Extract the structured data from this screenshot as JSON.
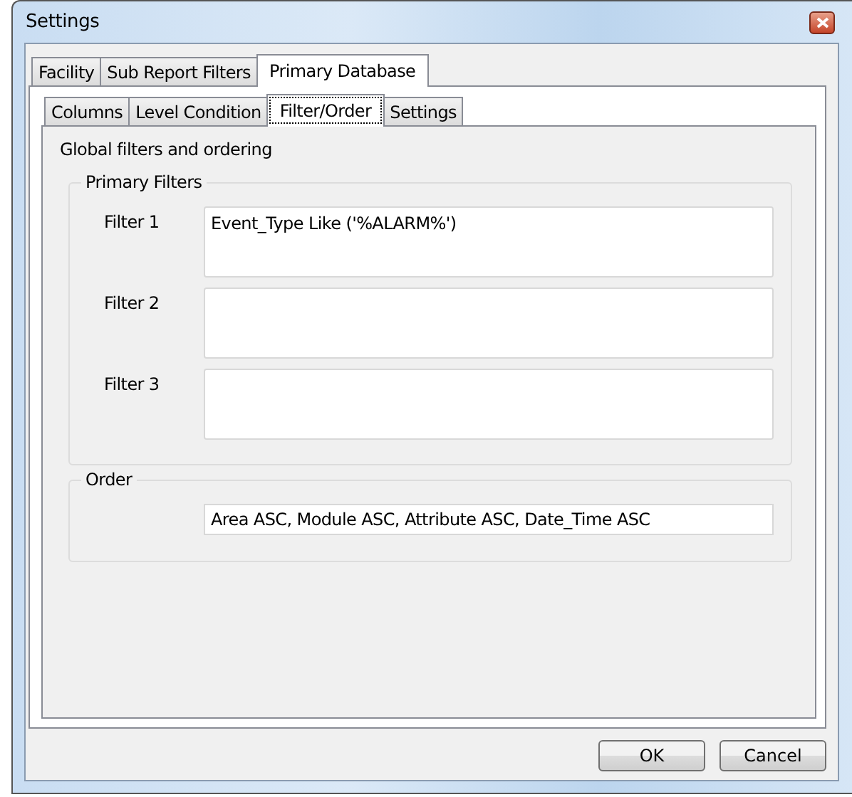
{
  "window": {
    "title": "Settings"
  },
  "tabs": [
    {
      "label": "Facility",
      "selected": false
    },
    {
      "label": "Sub Report Filters",
      "selected": false
    },
    {
      "label": "Primary Database",
      "selected": true
    }
  ],
  "subtabs": [
    {
      "label": "Columns",
      "selected": false
    },
    {
      "label": "Level Condition",
      "selected": false
    },
    {
      "label": "Filter/Order",
      "selected": true
    },
    {
      "label": "Settings",
      "selected": false
    }
  ],
  "description": "Global filters and ordering",
  "primary_filters": {
    "title": "Primary Filters",
    "filters": [
      {
        "label": "Filter 1",
        "value": "Event_Type Like ('%ALARM%')"
      },
      {
        "label": "Filter 2"
      },
      {
        "label": "Filter 3"
      }
    ]
  },
  "order": {
    "title": "Order",
    "value": "Area ASC, Module ASC, Attribute ASC, Date_Time ASC"
  },
  "buttons": [
    "OK",
    "Cancel"
  ]
}
